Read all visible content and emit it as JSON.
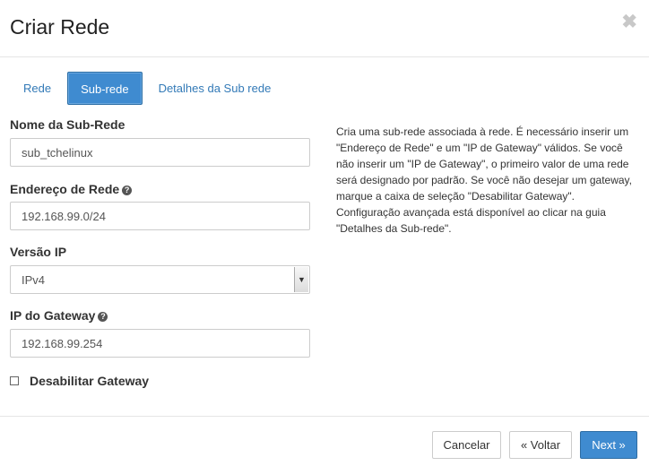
{
  "modal": {
    "title": "Criar Rede",
    "close_glyph": "✖"
  },
  "tabs": [
    {
      "label": "Rede",
      "active": false
    },
    {
      "label": "Sub-rede",
      "active": true
    },
    {
      "label": "Detalhes da Sub rede",
      "active": false
    }
  ],
  "form": {
    "subnet_name": {
      "label": "Nome da Sub-Rede",
      "value": "sub_tchelinux"
    },
    "network_address": {
      "label": "Endereço de Rede",
      "value": "192.168.99.0/24",
      "help_icon": "question-circle-icon"
    },
    "ip_version": {
      "label": "Versão IP",
      "value": "IPv4"
    },
    "gateway_ip": {
      "label": "IP do Gateway",
      "value": "192.168.99.254",
      "help_icon": "question-circle-icon"
    },
    "disable_gateway": {
      "label": "Desabilitar Gateway",
      "checked": false
    }
  },
  "help_text": "Cria uma sub-rede associada à rede. É necessário inserir um \"Endereço de Rede\" e um \"IP de Gateway\" válidos. Se você não inserir um \"IP de Gateway\", o primeiro valor de uma rede será designado por padrão. Se você não desejar um gateway, marque a caixa de seleção \"Desabilitar Gateway\". Configuração avançada está disponível ao clicar na guia \"Detalhes da Sub-rede\".",
  "footer": {
    "cancel_label": "Cancelar",
    "back_label": "« Voltar",
    "next_label": "Next »"
  },
  "colors": {
    "primary": "#3f8bd0",
    "link": "#337ab7"
  }
}
